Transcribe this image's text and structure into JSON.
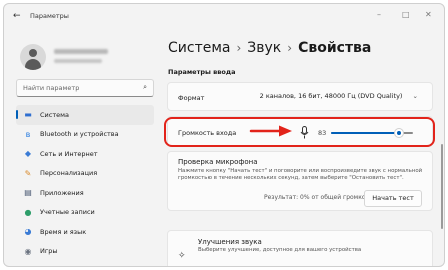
{
  "window": {
    "title": "Параметры",
    "back_glyph": "←",
    "controls": [
      "–",
      "□",
      "✕"
    ]
  },
  "sidebar": {
    "search_placeholder": "Найти параметр",
    "search_icon": "⌕",
    "items": [
      {
        "label": "Система",
        "icon": "display-icon",
        "glyph": "▬",
        "color": "#2f6fd0",
        "active": true
      },
      {
        "label": "Bluetooth и устройства",
        "icon": "bluetooth-icon",
        "glyph": "ʙ",
        "color": "#2b7de0",
        "active": false
      },
      {
        "label": "Сеть и Интернет",
        "icon": "wifi-icon",
        "glyph": "◆",
        "color": "#3a7bd5",
        "active": false
      },
      {
        "label": "Персонализация",
        "icon": "brush-icon",
        "glyph": "✎",
        "color": "#d98a2b",
        "active": false
      },
      {
        "label": "Приложения",
        "icon": "apps-icon",
        "glyph": "▤",
        "color": "#4a5a73",
        "active": false
      },
      {
        "label": "Учетные записи",
        "icon": "account-icon",
        "glyph": "●",
        "color": "#2e9e6a",
        "active": false
      },
      {
        "label": "Время и язык",
        "icon": "globe-clock-icon",
        "glyph": "◕",
        "color": "#3a7bd5",
        "active": false
      },
      {
        "label": "Игры",
        "icon": "gamepad-icon",
        "glyph": "◉",
        "color": "#6b7380",
        "active": false
      }
    ]
  },
  "breadcrumb": {
    "items": [
      "Система",
      "Звук"
    ],
    "separator": "›",
    "current": "Свойства"
  },
  "input_settings": {
    "heading": "Параметры ввода",
    "format_label": "Формат",
    "format_value": "2 каналов, 16 бит, 48000 Гц (DVD Quality)",
    "volume_label": "Громкость входа",
    "volume_value": "83",
    "volume_level": 0.83
  },
  "mic_test": {
    "title": "Проверка микрофона",
    "description": "Нажмите кнопку \"Начать тест\" и поговорите или воспроизведите звук с нормальной громкостью в течение нескольких секунд, затем выберите \"Остановить тест\".",
    "result": "Результат: 0% от общей громкости",
    "button": "Начать тест"
  },
  "enhancements": {
    "title": "Улучшения звука",
    "description": "Выберите улучшение, доступное для вашего устройства"
  },
  "colors": {
    "accent": "#005fb8",
    "highlight": "#e2231a"
  }
}
